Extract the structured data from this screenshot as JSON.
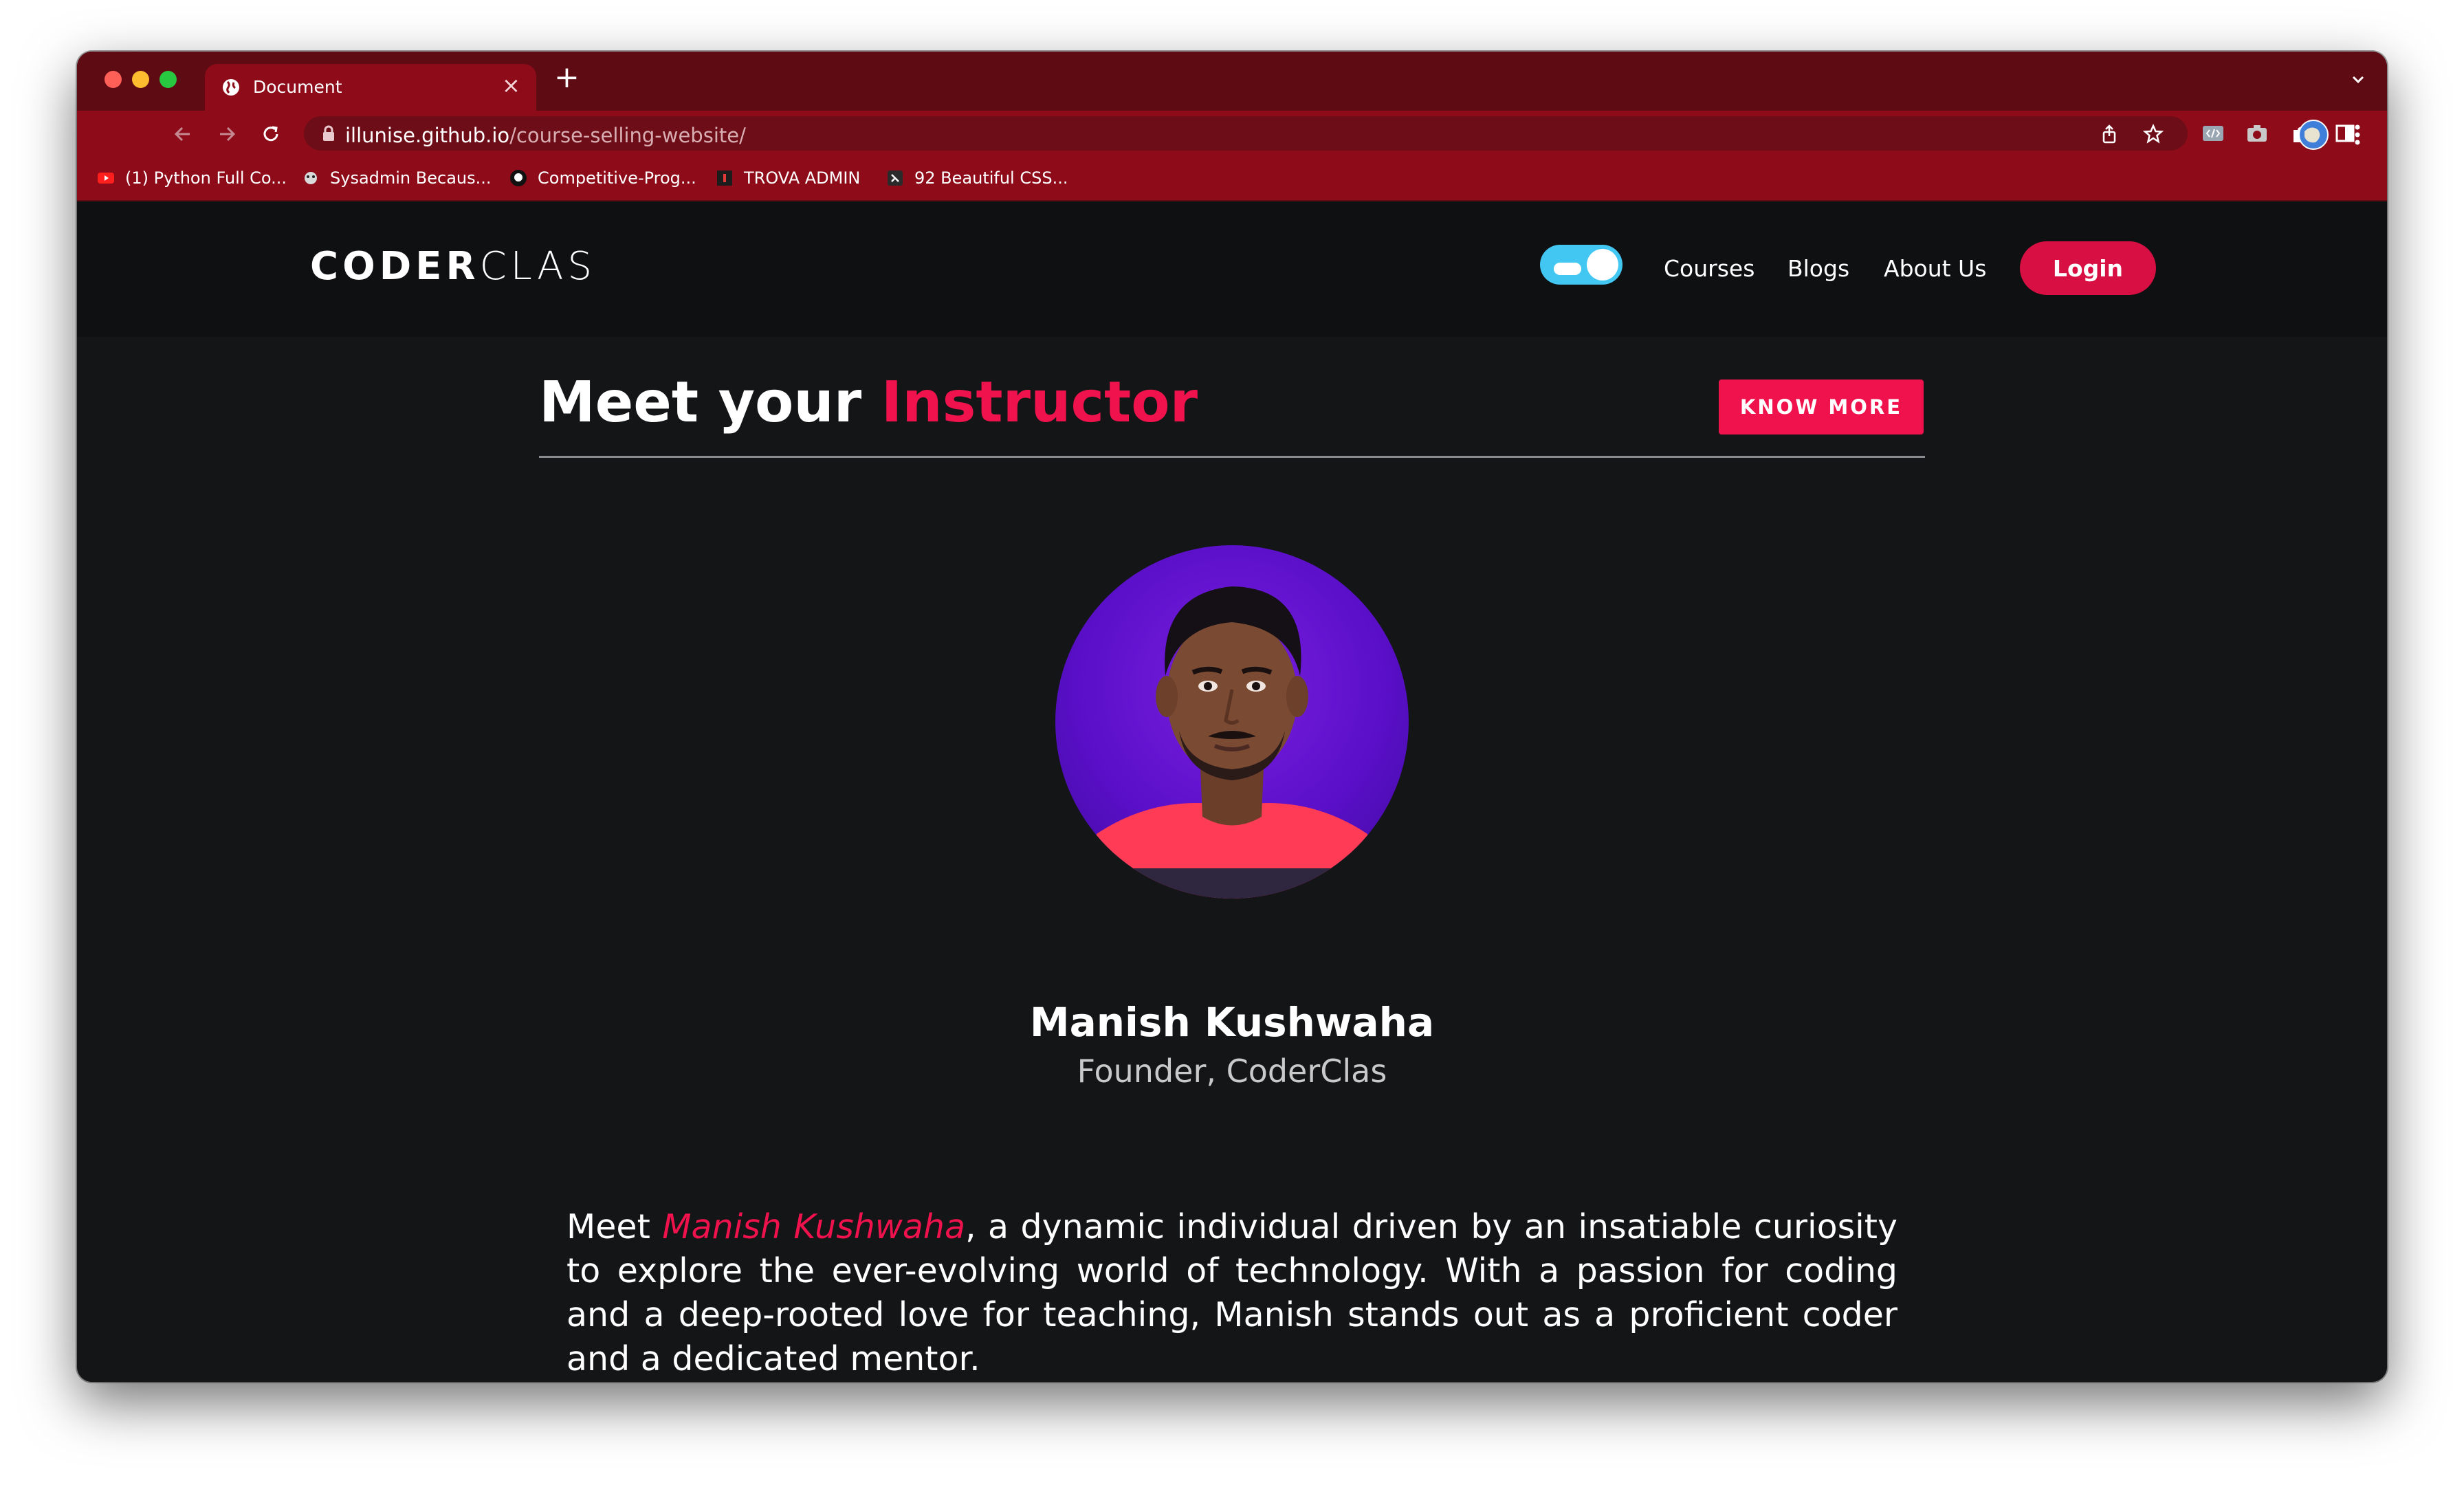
{
  "browser": {
    "tab": {
      "title": "Document",
      "close_glyph": "×",
      "icon": "globe-icon"
    },
    "new_tab_glyph": "+",
    "address": {
      "host": "illunise.github.io",
      "path": "/course-selling-website/"
    },
    "bookmarks": [
      {
        "label": "(1) Python Full Co...",
        "icon": "youtube-icon"
      },
      {
        "label": "Sysadmin Becaus...",
        "icon": "sysadmin-icon"
      },
      {
        "label": "Competitive-Prog...",
        "icon": "github-icon"
      },
      {
        "label": "TROVA ADMIN",
        "icon": "trova-icon"
      },
      {
        "label": "92 Beautiful CSS...",
        "icon": "css-icon"
      }
    ],
    "theme_color": "#8e0c1a"
  },
  "site": {
    "logo": {
      "bold": "CODER",
      "light": "CLAS"
    },
    "nav": {
      "courses": "Courses",
      "blogs": "Blogs",
      "about": "About Us"
    },
    "login_label": "Login",
    "accent_color": "#f0124d"
  },
  "section": {
    "title_plain": "Meet your ",
    "title_accent": "Instructor",
    "know_more": "KNOW MORE"
  },
  "instructor": {
    "name": "Manish Kushwaha",
    "role": "Founder, CoderClas",
    "bio_prefix": "Meet ",
    "bio_name": "Manish Kushwaha",
    "bio_rest": ", a dynamic individual driven by an insatiable curiosity to explore the ever-evolving world of technology. With a passion for coding and a deep-rooted love for teaching, Manish stands out as a proficient coder and a dedicated mentor."
  }
}
